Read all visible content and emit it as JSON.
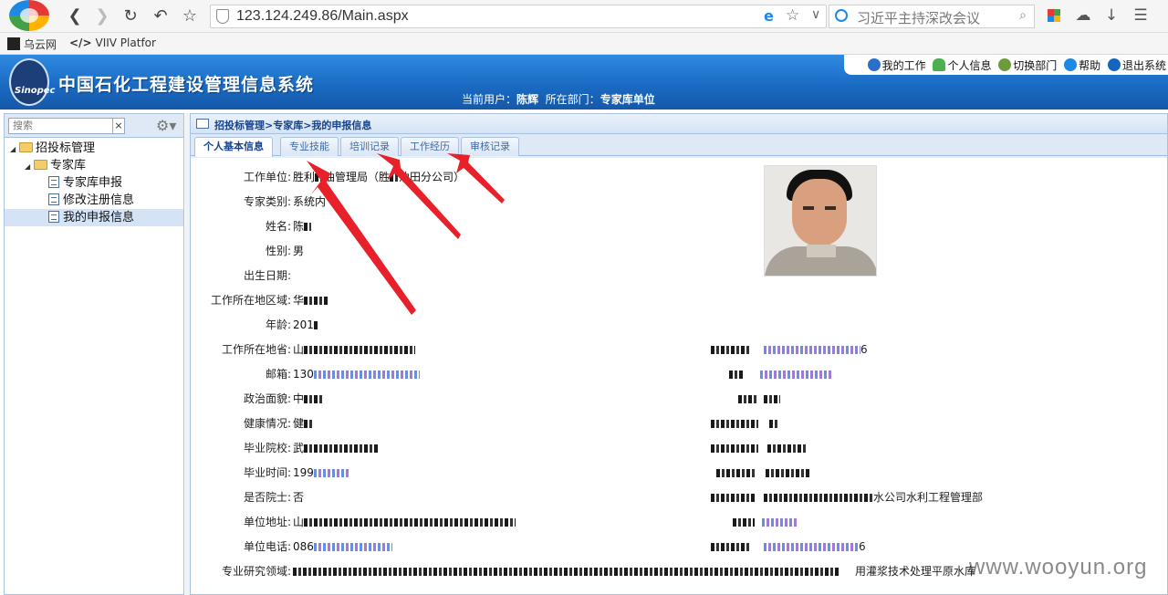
{
  "browser": {
    "url": "123.124.249.86/Main.aspx",
    "search_placeholder": "习近平主持深改会议",
    "bookmarks": [
      "乌云网",
      "VIIV Platfor"
    ],
    "bookmark_code_glyph": "</>"
  },
  "app": {
    "title": "中国石化工程建设管理信息系统",
    "logo_text": "Sinopec",
    "top_links": [
      "我的工作",
      "个人信息",
      "切换部门",
      "帮助",
      "退出系统"
    ],
    "current_user_label": "当前用户：",
    "current_user": "陈辉",
    "department_label": "所在部门：",
    "department": "专家库单位"
  },
  "sidebar": {
    "search_placeholder": "搜索",
    "clear_label": "×",
    "tree": [
      {
        "label": "招投标管理",
        "type": "folder",
        "level": 0
      },
      {
        "label": "专家库",
        "type": "folder",
        "level": 1
      },
      {
        "label": "专家库申报",
        "type": "doc",
        "level": 2
      },
      {
        "label": "修改注册信息",
        "type": "doc",
        "level": 2
      },
      {
        "label": "我的申报信息",
        "type": "doc",
        "level": 2,
        "selected": true
      }
    ]
  },
  "main": {
    "breadcrumb": "招投标管理>专家库>我的申报信息",
    "tabs": [
      "个人基本信息",
      "专业技能",
      "培训记录",
      "工作经历",
      "审核记录"
    ],
    "active_tab": 0,
    "fields": [
      {
        "label": "工作单位:",
        "value": "胜利",
        "value2": "油管理局（胜",
        "value3": "油田分公司）"
      },
      {
        "label": "专家类别:",
        "value": "系统内"
      },
      {
        "label": "姓名:",
        "value": "陈"
      },
      {
        "label": "性别:",
        "value": "男"
      },
      {
        "label": "出生日期:",
        "value": ""
      },
      {
        "label": "工作所在地区域:",
        "value": "华"
      },
      {
        "label": "年龄:",
        "value": "201"
      },
      {
        "label": "工作所在地省:",
        "value": "山"
      },
      {
        "label": "邮箱:",
        "value": "130"
      },
      {
        "label": "政治面貌:",
        "value": "中"
      },
      {
        "label": "健康情况:",
        "value": "健"
      },
      {
        "label": "毕业院校:",
        "value": "武"
      },
      {
        "label": "毕业时间:",
        "value": "199"
      },
      {
        "label": "是否院士:",
        "value": "否"
      },
      {
        "label": "单位地址:",
        "value": "山"
      },
      {
        "label": "单位电话:",
        "value": "086"
      },
      {
        "label": "专业研究领域:",
        "value": ""
      }
    ],
    "right_values": [
      {
        "value": "6"
      },
      {
        "value": ""
      },
      {
        "value": ""
      },
      {
        "value": ""
      },
      {
        "value": ""
      },
      {
        "value": ""
      },
      {
        "value": "水公司水利工程管理部"
      },
      {
        "value": ""
      },
      {
        "value": "6"
      },
      {
        "value": "用灌浆技术处理平原水库"
      }
    ]
  },
  "watermark": "www.wooyun.org",
  "colors": {
    "header_blue": "#1a6bc4",
    "arrow_red": "#e8202a"
  }
}
